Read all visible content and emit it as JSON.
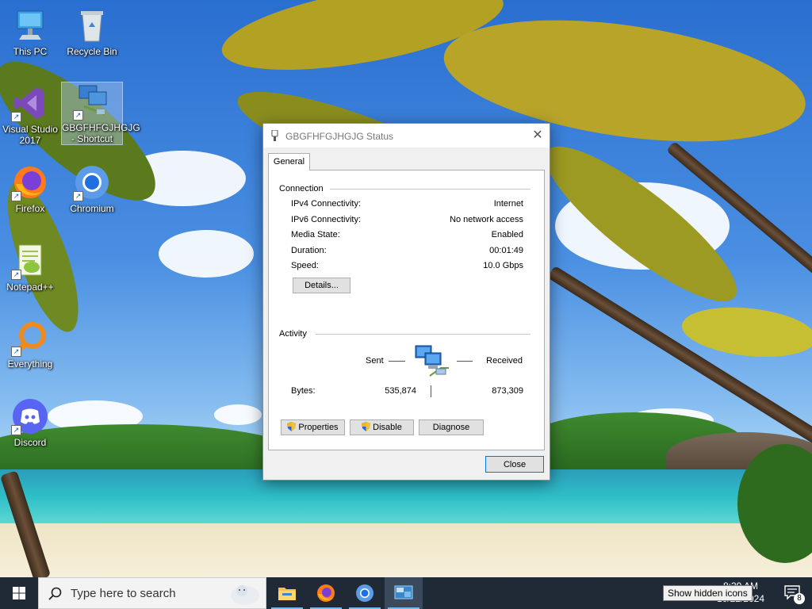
{
  "desktop": {
    "icons": [
      {
        "label": "This PC"
      },
      {
        "label": "Recycle Bin"
      },
      {
        "label": "Visual Studio 2017"
      },
      {
        "label": "GBGFHFGJHGJG - Shortcut"
      },
      {
        "label": "Firefox"
      },
      {
        "label": "Chromium"
      },
      {
        "label": "Notepad++"
      },
      {
        "label": "Everything"
      },
      {
        "label": "Discord"
      }
    ]
  },
  "dialog": {
    "title": "GBGFHFGJHGJG Status",
    "tab": "General",
    "connection": {
      "heading": "Connection",
      "rows": [
        {
          "label": "IPv4 Connectivity:",
          "value": "Internet"
        },
        {
          "label": "IPv6 Connectivity:",
          "value": "No network access"
        },
        {
          "label": "Media State:",
          "value": "Enabled"
        },
        {
          "label": "Duration:",
          "value": "00:01:49"
        },
        {
          "label": "Speed:",
          "value": "10.0 Gbps"
        }
      ],
      "details_button": "Details..."
    },
    "activity": {
      "heading": "Activity",
      "sent_label": "Sent",
      "received_label": "Received",
      "bytes_label": "Bytes:",
      "bytes_sent": "535,874",
      "bytes_received": "873,309"
    },
    "buttons": {
      "properties": "Properties",
      "disable": "Disable",
      "diagnose": "Diagnose",
      "close": "Close"
    }
  },
  "taskbar": {
    "search_placeholder": "Type here to search",
    "time": "8:39 AM",
    "date": "10/22/2024",
    "tooltip": "Show hidden icons",
    "notification_count": "8"
  }
}
